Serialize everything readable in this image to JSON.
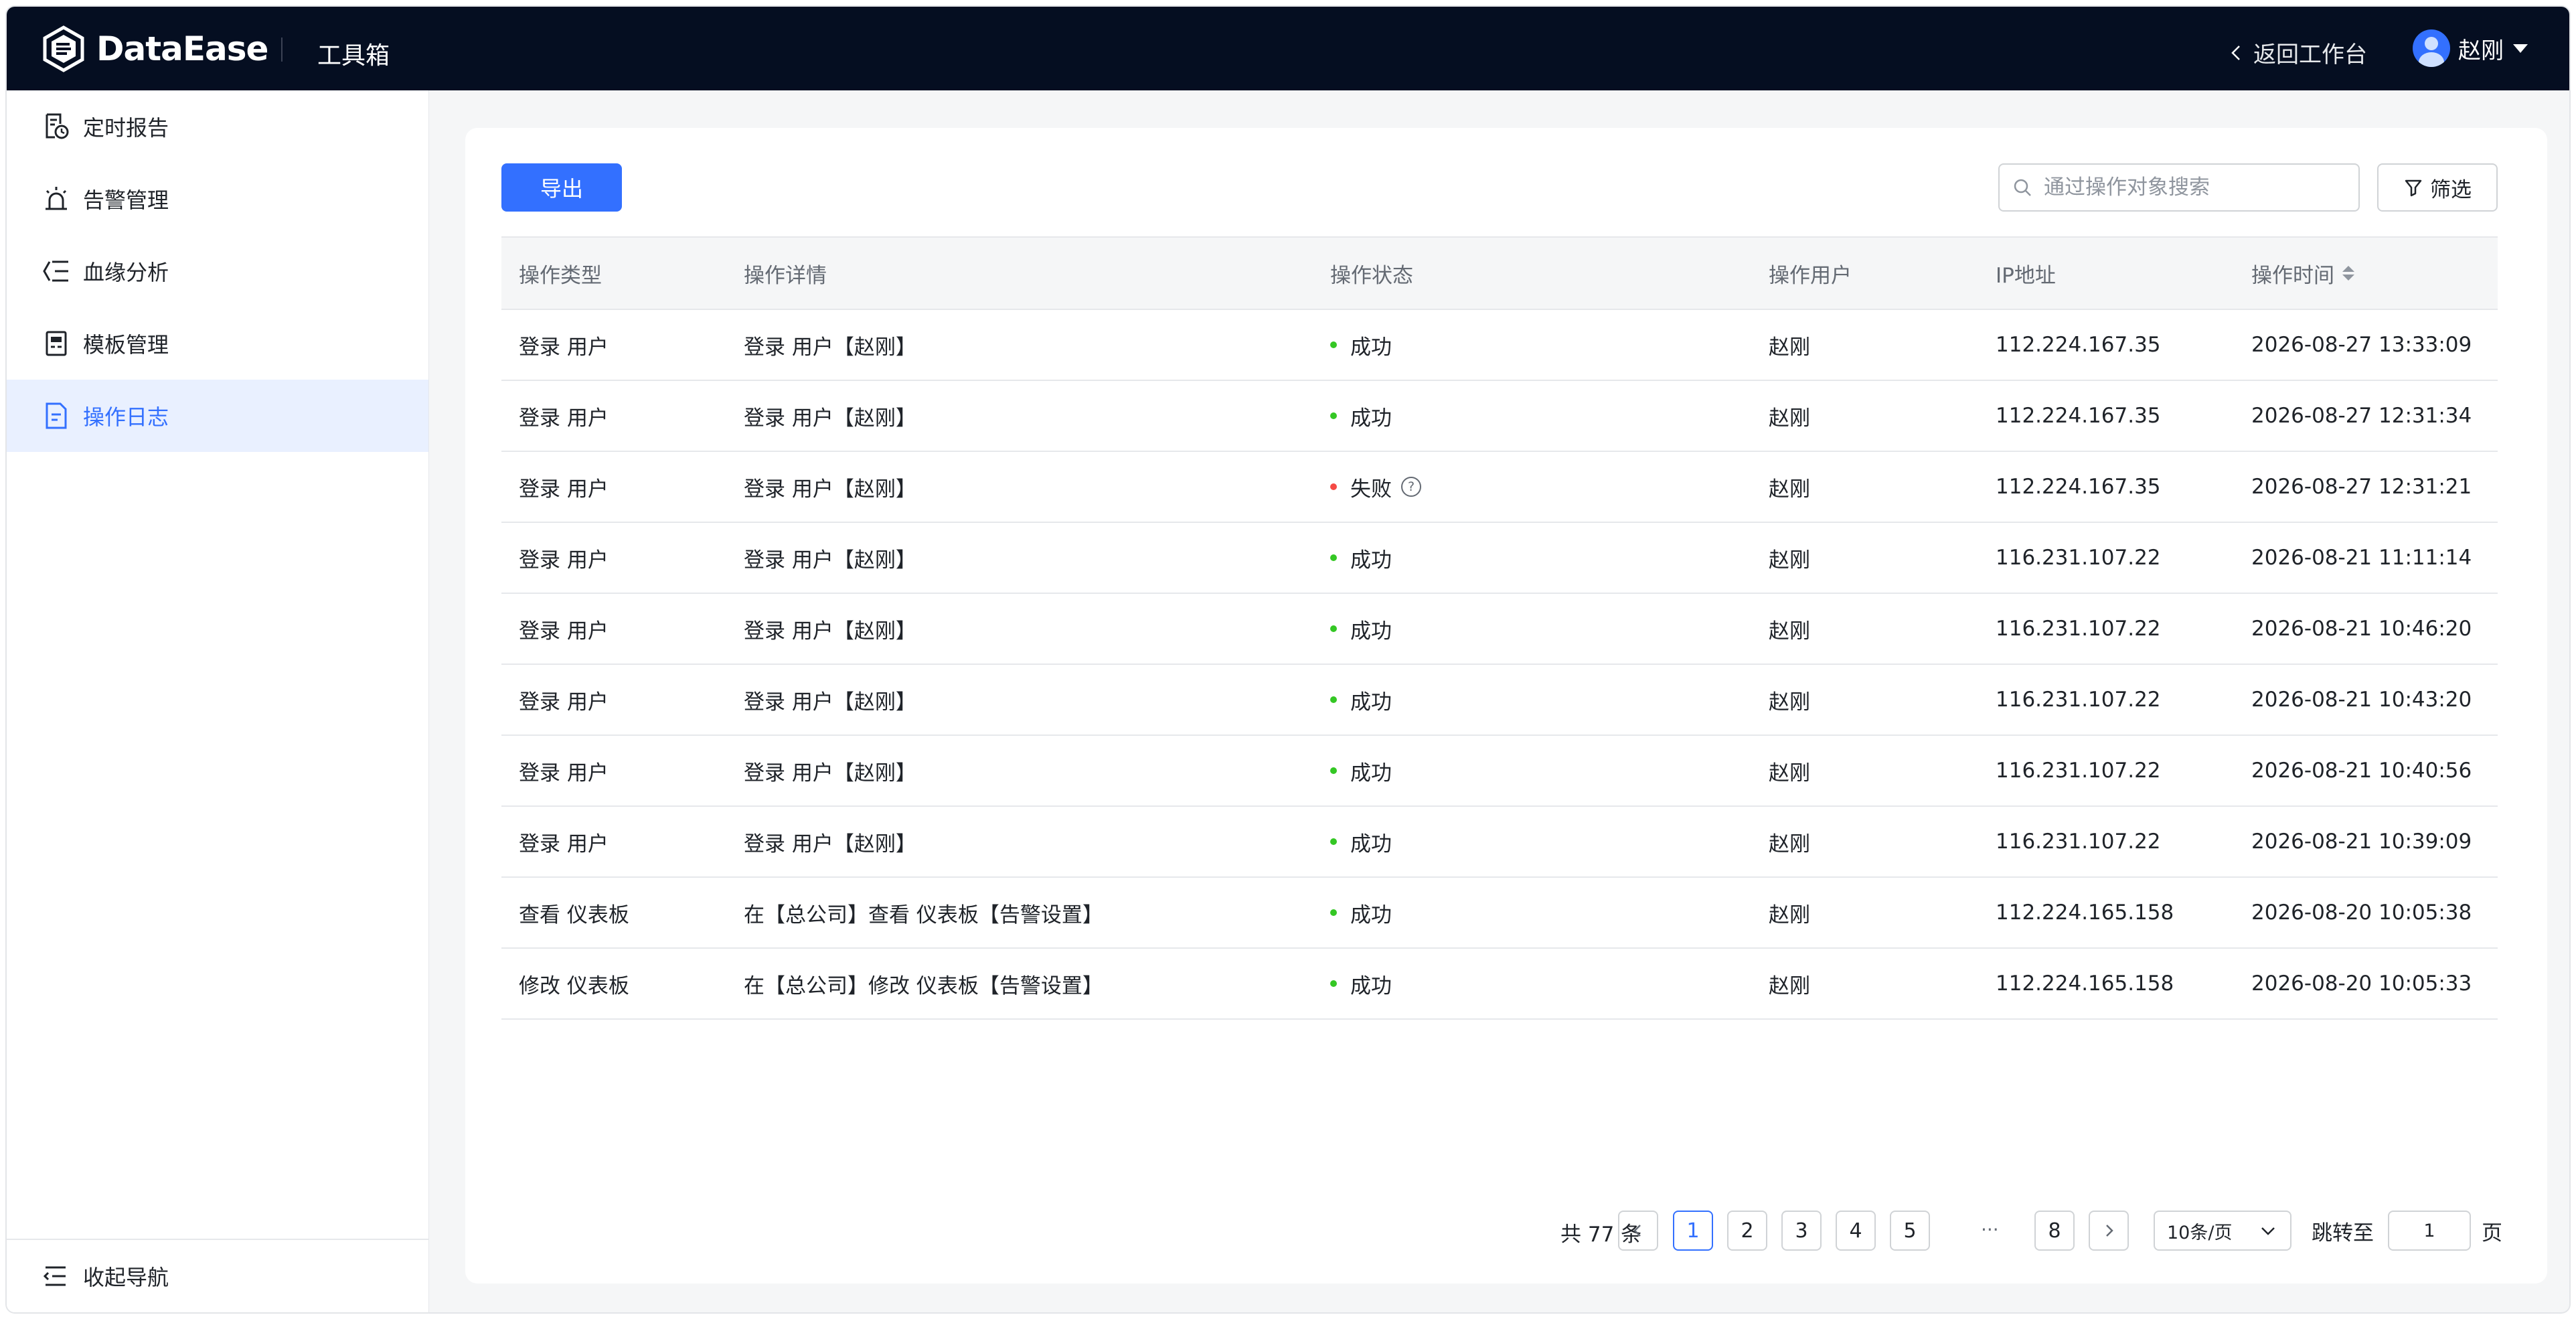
{
  "header": {
    "logo_text": "DataEase",
    "app_name": "工具箱",
    "back_label": "返回工作台",
    "user_name": "赵刚"
  },
  "sidebar": {
    "items": [
      {
        "label": "定时报告",
        "icon": "scheduled-report-icon"
      },
      {
        "label": "告警管理",
        "icon": "alarm-icon"
      },
      {
        "label": "血缘分析",
        "icon": "lineage-icon"
      },
      {
        "label": "模板管理",
        "icon": "template-icon"
      },
      {
        "label": "操作日志",
        "icon": "log-icon",
        "active": true
      }
    ],
    "collapse_label": "收起导航"
  },
  "toolbar": {
    "export_label": "导出",
    "search_placeholder": "通过操作对象搜索",
    "filter_label": "筛选"
  },
  "table": {
    "columns": [
      "操作类型",
      "操作详情",
      "操作状态",
      "操作用户",
      "IP地址",
      "操作时间"
    ],
    "rows": [
      {
        "type": "登录 用户",
        "detail": "登录 用户【赵刚】",
        "status": "成功",
        "ok": true,
        "user": "赵刚",
        "ip": "112.224.167.35",
        "time": "2026-08-27 13:33:09"
      },
      {
        "type": "登录 用户",
        "detail": "登录 用户【赵刚】",
        "status": "成功",
        "ok": true,
        "user": "赵刚",
        "ip": "112.224.167.35",
        "time": "2026-08-27 12:31:34"
      },
      {
        "type": "登录 用户",
        "detail": "登录 用户【赵刚】",
        "status": "失败",
        "ok": false,
        "user": "赵刚",
        "ip": "112.224.167.35",
        "time": "2026-08-27 12:31:21"
      },
      {
        "type": "登录 用户",
        "detail": "登录 用户【赵刚】",
        "status": "成功",
        "ok": true,
        "user": "赵刚",
        "ip": "116.231.107.22",
        "time": "2026-08-21 11:11:14"
      },
      {
        "type": "登录 用户",
        "detail": "登录 用户【赵刚】",
        "status": "成功",
        "ok": true,
        "user": "赵刚",
        "ip": "116.231.107.22",
        "time": "2026-08-21 10:46:20"
      },
      {
        "type": "登录 用户",
        "detail": "登录 用户【赵刚】",
        "status": "成功",
        "ok": true,
        "user": "赵刚",
        "ip": "116.231.107.22",
        "time": "2026-08-21 10:43:20"
      },
      {
        "type": "登录 用户",
        "detail": "登录 用户【赵刚】",
        "status": "成功",
        "ok": true,
        "user": "赵刚",
        "ip": "116.231.107.22",
        "time": "2026-08-21 10:40:56"
      },
      {
        "type": "登录 用户",
        "detail": "登录 用户【赵刚】",
        "status": "成功",
        "ok": true,
        "user": "赵刚",
        "ip": "116.231.107.22",
        "time": "2026-08-21 10:39:09"
      },
      {
        "type": "查看 仪表板",
        "detail": "在【总公司】查看 仪表板【告警设置】",
        "status": "成功",
        "ok": true,
        "user": "赵刚",
        "ip": "112.224.165.158",
        "time": "2026-08-20 10:05:38"
      },
      {
        "type": "修改 仪表板",
        "detail": "在【总公司】修改 仪表板【告警设置】",
        "status": "成功",
        "ok": true,
        "user": "赵刚",
        "ip": "112.224.165.158",
        "time": "2026-08-20 10:05:33"
      }
    ]
  },
  "pagination": {
    "total_text": "共 77 条",
    "pages": [
      "1",
      "2",
      "3",
      "4",
      "5"
    ],
    "ellipsis": "···",
    "last_page": "8",
    "current_page": 1,
    "page_size": "10条/页",
    "jump_label": "跳转至",
    "jump_value": "1",
    "page_suffix": "页"
  },
  "colors": {
    "header_bg": "#050e21",
    "accent": "#3370ff",
    "success": "#34c724",
    "fail": "#f54a45"
  }
}
